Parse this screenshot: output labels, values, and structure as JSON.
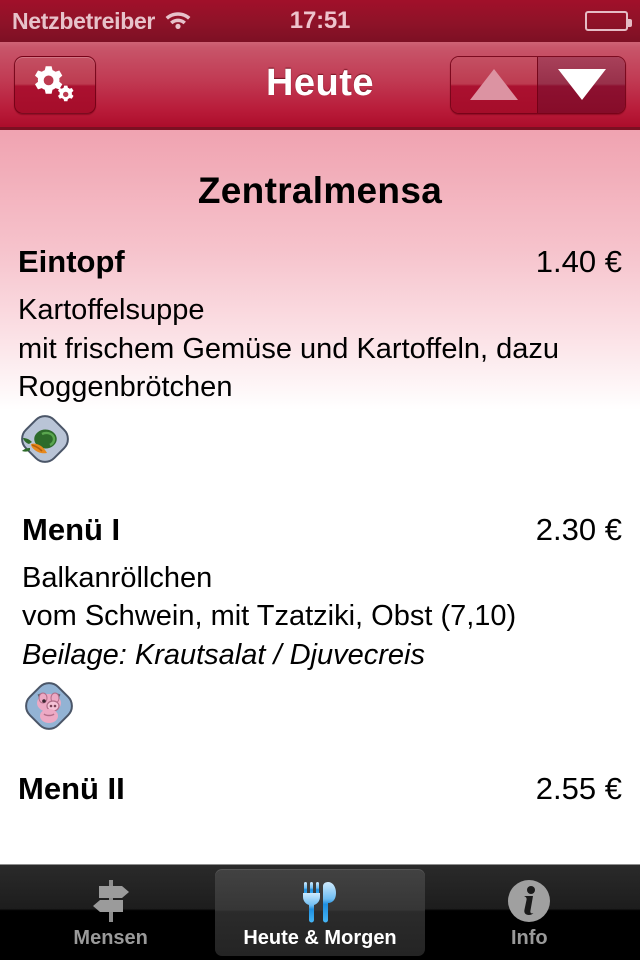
{
  "status_bar": {
    "carrier": "Netzbetreiber",
    "wifi_icon": "wifi-icon",
    "time": "17:51",
    "battery_icon": "battery-icon"
  },
  "nav_bar": {
    "title": "Heute",
    "settings_button_icon": "gears-icon",
    "prev_button_icon": "triangle-up-icon",
    "next_button_icon": "triangle-down-icon",
    "prev_enabled": false,
    "next_enabled": true,
    "colors": {
      "bar_top": "#c8566a",
      "bar_bottom": "#ad0e2c",
      "title_text": "#ffffff"
    }
  },
  "content": {
    "mensa_title": "Zentralmensa",
    "background_top_color": "#f0a3b1",
    "background_bottom_color": "#ffffff",
    "meals": [
      {
        "name": "Eintopf",
        "price": "1.40 €",
        "description_lines": [
          "Kartoffelsuppe",
          "mit frischem Gemüse und Kartoffeln, dazu",
          "Roggenbrötchen"
        ],
        "side": "",
        "badge_icon": "vegetarian-icon"
      },
      {
        "name": "Menü I",
        "price": "2.30 €",
        "description_lines": [
          "Balkanröllchen",
          "vom Schwein, mit Tzatziki, Obst (7,10)"
        ],
        "side": "Beilage: Krautsalat / Djuvecreis",
        "badge_icon": "pork-icon"
      },
      {
        "name": "Menü II",
        "price": "2.55 €",
        "description_lines": [],
        "side": "",
        "badge_icon": ""
      }
    ]
  },
  "tab_bar": {
    "tabs": [
      {
        "label": "Mensen",
        "icon": "signpost-icon",
        "selected": false
      },
      {
        "label": "Heute & Morgen",
        "icon": "fork-knife-icon",
        "selected": true
      },
      {
        "label": "Info",
        "icon": "info-circle-icon",
        "selected": false
      }
    ],
    "selected_index": 1,
    "accent_color": "#3aa6e8"
  }
}
